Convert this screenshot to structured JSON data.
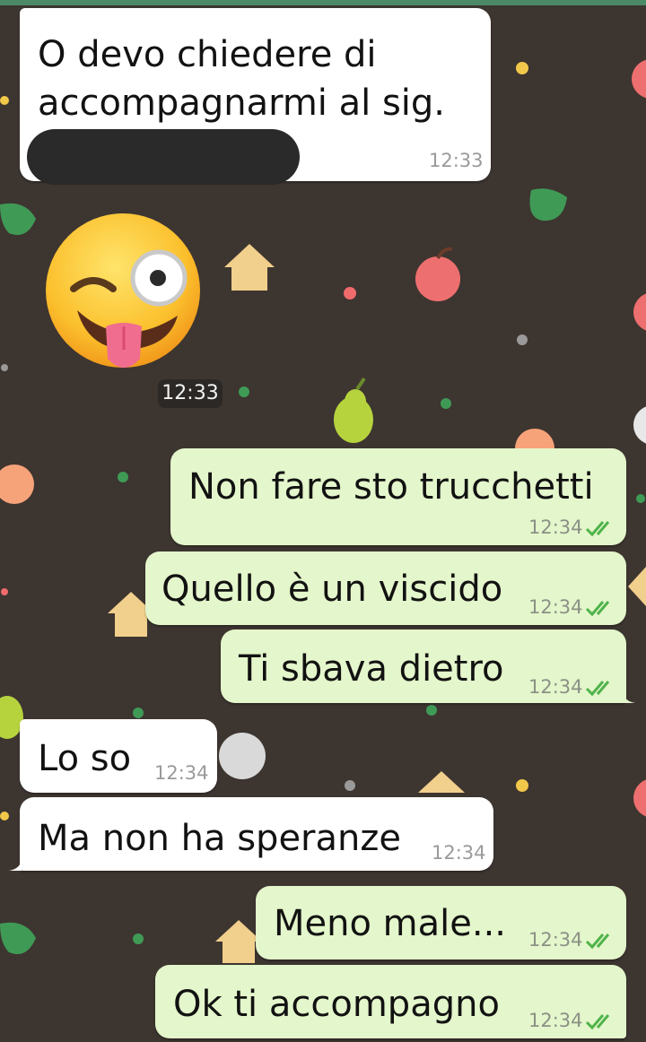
{
  "chat": {
    "messages": [
      {
        "id": "m1",
        "direction": "incoming",
        "lines": [
          "O devo chiedere di",
          "accompagnarmi al sig."
        ],
        "time": "12:33",
        "redacted": true
      },
      {
        "id": "m2",
        "direction": "incoming",
        "type": "sticker",
        "emoji": "winking-face-with-tongue",
        "time": "12:33"
      },
      {
        "id": "m3",
        "direction": "outgoing",
        "text": "Non fare sto trucchetti",
        "time": "12:34",
        "status": "read"
      },
      {
        "id": "m4",
        "direction": "outgoing",
        "text": "Quello è un viscido",
        "time": "12:34",
        "status": "read"
      },
      {
        "id": "m5",
        "direction": "outgoing",
        "text": "Ti sbava dietro",
        "time": "12:34",
        "status": "read"
      },
      {
        "id": "m6",
        "direction": "incoming",
        "text": "Lo so",
        "time": "12:34"
      },
      {
        "id": "m7",
        "direction": "incoming",
        "text": "Ma non ha speranze",
        "time": "12:34"
      },
      {
        "id": "m8",
        "direction": "outgoing",
        "text": "Meno male...",
        "time": "12:34",
        "status": "read"
      },
      {
        "id": "m9",
        "direction": "outgoing",
        "text": "Ok ti accompagno",
        "time": "12:34",
        "status": "read"
      }
    ]
  },
  "colors": {
    "wallpaper": "#3d3530",
    "incoming_bubble": "#ffffff",
    "outgoing_bubble": "#e4f6cb",
    "read_tick": "#4fb34a",
    "accent_bar": "#4a8a66"
  },
  "icons": {
    "read_receipt": "double-check-icon",
    "sticker": "winking-face-with-tongue-icon"
  }
}
